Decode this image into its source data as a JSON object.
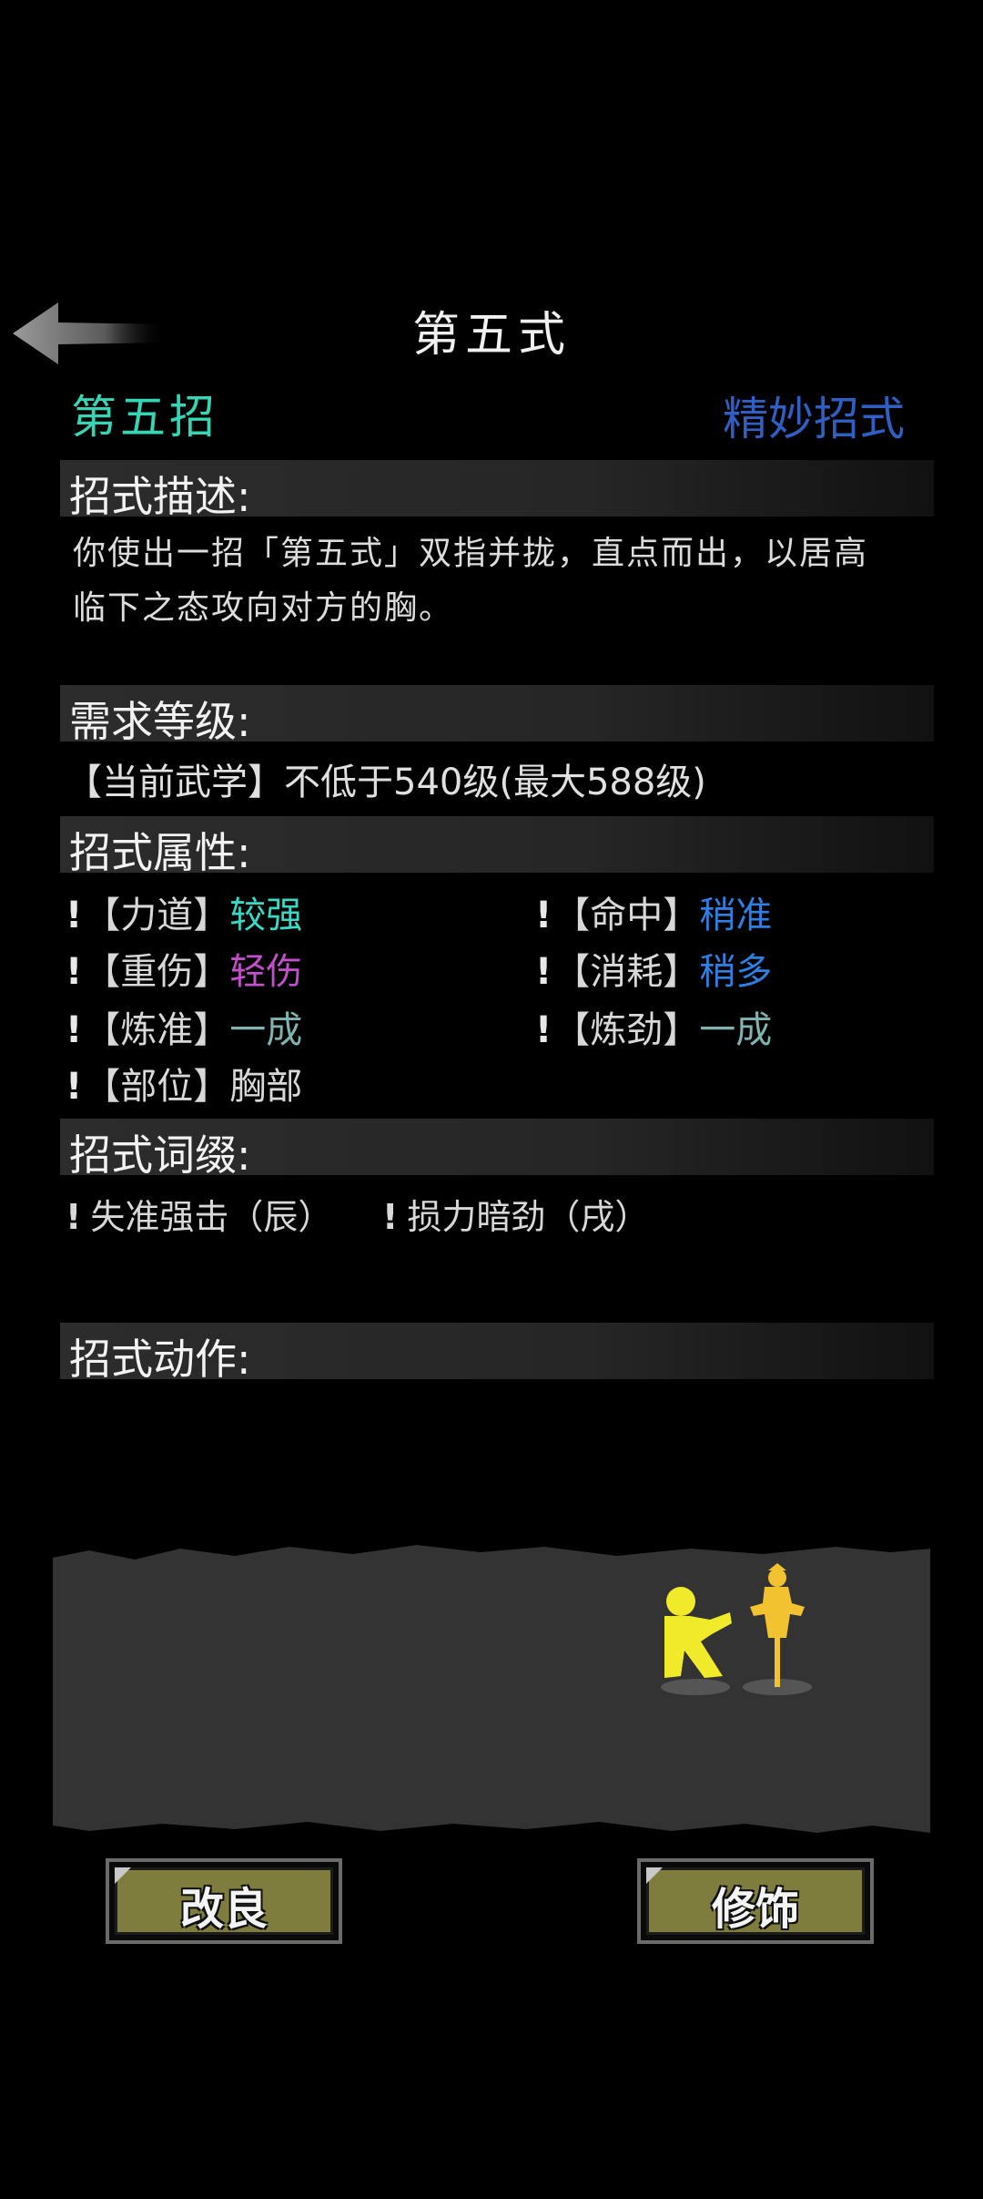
{
  "header": {
    "title": "第五式"
  },
  "move": {
    "name": "第五招",
    "grade": "精妙招式"
  },
  "sections": {
    "description_title": "招式描述:",
    "requirement_title": "需求等级:",
    "attributes_title": "招式属性:",
    "affixes_title": "招式词缀:",
    "action_title": "招式动作:"
  },
  "description": "你使出一招「第五式」双指并拢，直点而出，以居高临下之态攻向对方的胸。",
  "requirement": "【当前武学】不低于540级(最大588级)",
  "attributes": [
    {
      "label": "【力道】",
      "value": "较强",
      "color": "#39d9c7"
    },
    {
      "label": "【命中】",
      "value": "稍准",
      "color": "#2f7fe0"
    },
    {
      "label": "【重伤】",
      "value": "轻伤",
      "color": "#c24fc9"
    },
    {
      "label": "【消耗】",
      "value": "稍多",
      "color": "#2f7fe0"
    },
    {
      "label": "【炼准】",
      "value": "一成",
      "color": "#7fb3b0"
    },
    {
      "label": "【炼劲】",
      "value": "一成",
      "color": "#7fb3b0"
    },
    {
      "label": "【部位】",
      "value": "胸部",
      "color": "#d8d8d8"
    }
  ],
  "affixes": [
    "失准强击（辰）",
    "损力暗劲（戌）"
  ],
  "bang": "!",
  "buttons": {
    "improve": "改良",
    "decorate": "修饰"
  },
  "colors": {
    "background": "#000000",
    "stage": "#333333",
    "button": "#7f7d3e",
    "fighter": "#f0ea2a",
    "dummy": "#f2c230"
  }
}
